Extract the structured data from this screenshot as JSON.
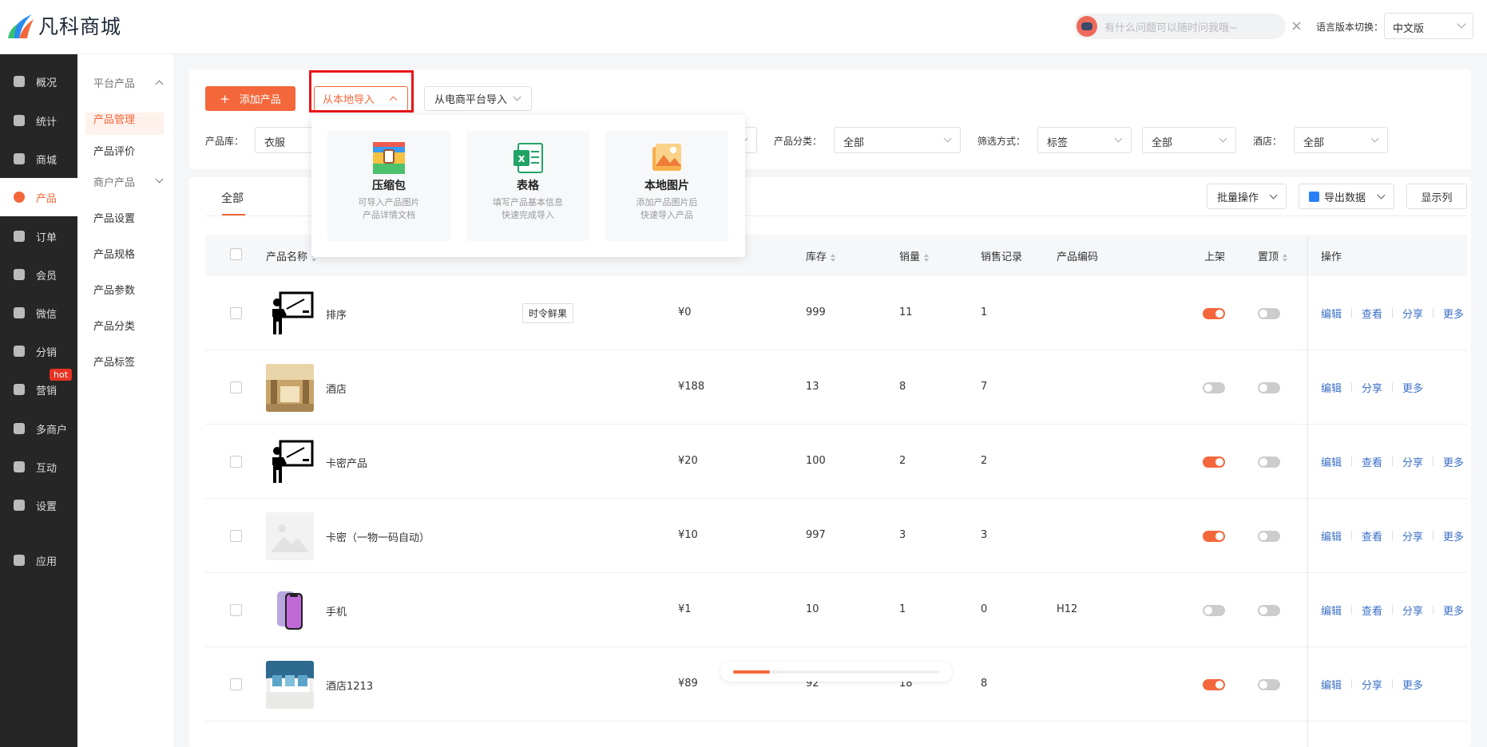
{
  "header": {
    "brand": "凡科商城",
    "assistant_placeholder": "有什么问题可以随时问我哦~",
    "lang_label": "语言版本切换：",
    "lang_value": "中文版"
  },
  "nav": [
    {
      "label": "概况",
      "icon": "layers-icon"
    },
    {
      "label": "统计",
      "icon": "chart-icon"
    },
    {
      "label": "商城",
      "icon": "store-icon"
    },
    {
      "label": "产品",
      "icon": "product-icon",
      "active": true
    },
    {
      "label": "订单",
      "icon": "order-icon"
    },
    {
      "label": "会员",
      "icon": "crown-icon"
    },
    {
      "label": "微信",
      "icon": "wechat-icon"
    },
    {
      "label": "分销",
      "icon": "distribution-icon"
    },
    {
      "label": "营销",
      "icon": "flag-icon",
      "badge": "hot"
    },
    {
      "label": "多商户",
      "icon": "merchant-icon"
    },
    {
      "label": "互动",
      "icon": "interact-icon"
    },
    {
      "label": "设置",
      "icon": "gear-icon"
    },
    {
      "label": "应用",
      "icon": "apps-icon"
    }
  ],
  "subnav": [
    {
      "label": "平台产品",
      "group": true
    },
    {
      "label": "产品管理",
      "active": true
    },
    {
      "label": "产品评价"
    },
    {
      "label": "商户产品",
      "group": true
    },
    {
      "label": "产品设置"
    },
    {
      "label": "产品规格"
    },
    {
      "label": "产品参数"
    },
    {
      "label": "产品分类"
    },
    {
      "label": "产品标签"
    }
  ],
  "toolbar": {
    "add_label": "添加产品",
    "local_import_label": "从本地导入",
    "ecom_import_label": "从电商平台导入"
  },
  "filters": {
    "library_label": "产品库：",
    "library_value": "衣服",
    "category_label": "产品分类：",
    "category_value": "全部",
    "filter_label": "筛选方式：",
    "filter_value": "标签",
    "filter_value2": "全部",
    "hotel_label": "酒店：",
    "hotel_value": "全部"
  },
  "import_popover": [
    {
      "title": "压缩包",
      "desc1": "可导入产品图片",
      "desc2": "产品详情文档",
      "icon": "zip-icon"
    },
    {
      "title": "表格",
      "desc1": "填写产品基本信息",
      "desc2": "快速完成导入",
      "icon": "excel-icon"
    },
    {
      "title": "本地图片",
      "desc1": "添加产品图片后",
      "desc2": "快速导入产品",
      "icon": "image-icon"
    }
  ],
  "tabs": {
    "all": "全部"
  },
  "table_tools": {
    "batch": "批量操作",
    "export": "导出数据",
    "columns": "显示列"
  },
  "table": {
    "headers": {
      "name": "产品名称",
      "stock": "库存",
      "sales": "销量",
      "sales_record": "销售记录",
      "code": "产品编码",
      "on_shelf": "上架",
      "top": "置顶",
      "ops": "操作"
    },
    "rows": [
      {
        "name": "排序",
        "tag": "时令鲜果",
        "price": "¥0",
        "stock": "999",
        "sales": "11",
        "record": "1",
        "code": "",
        "on": true,
        "top": false,
        "ops": [
          "编辑",
          "查看",
          "分享",
          "更多"
        ],
        "thumb": "presenter"
      },
      {
        "name": "酒店",
        "tag": "",
        "price": "¥188",
        "stock": "13",
        "sales": "8",
        "record": "7",
        "code": "",
        "on": false,
        "top": false,
        "ops": [
          "编辑",
          "分享",
          "更多"
        ],
        "thumb": "hotel"
      },
      {
        "name": "卡密产品",
        "tag": "",
        "price": "¥20",
        "stock": "100",
        "sales": "2",
        "record": "2",
        "code": "",
        "on": true,
        "top": false,
        "ops": [
          "编辑",
          "查看",
          "分享",
          "更多"
        ],
        "thumb": "presenter"
      },
      {
        "name": "卡密（一物一码自动）",
        "tag": "",
        "price": "¥10",
        "stock": "997",
        "sales": "3",
        "record": "3",
        "code": "",
        "on": true,
        "top": false,
        "ops": [
          "编辑",
          "查看",
          "分享",
          "更多"
        ],
        "thumb": "placeholder"
      },
      {
        "name": "手机",
        "tag": "",
        "price": "¥1",
        "stock": "10",
        "sales": "1",
        "record": "0",
        "code": "H12",
        "on": false,
        "top": false,
        "ops": [
          "编辑",
          "查看",
          "分享",
          "更多"
        ],
        "thumb": "phone"
      },
      {
        "name": "酒店1213",
        "tag": "",
        "price": "¥89",
        "stock": "92",
        "sales": "18",
        "record": "8",
        "code": "",
        "on": true,
        "top": false,
        "ops": [
          "编辑",
          "分享",
          "更多"
        ],
        "thumb": "room"
      }
    ]
  },
  "loading_progress": 0.18,
  "colors": {
    "accent": "#f4673b",
    "link": "#3b6fc7",
    "nav_bg": "#262626",
    "highlight_box": "#e8151b"
  }
}
